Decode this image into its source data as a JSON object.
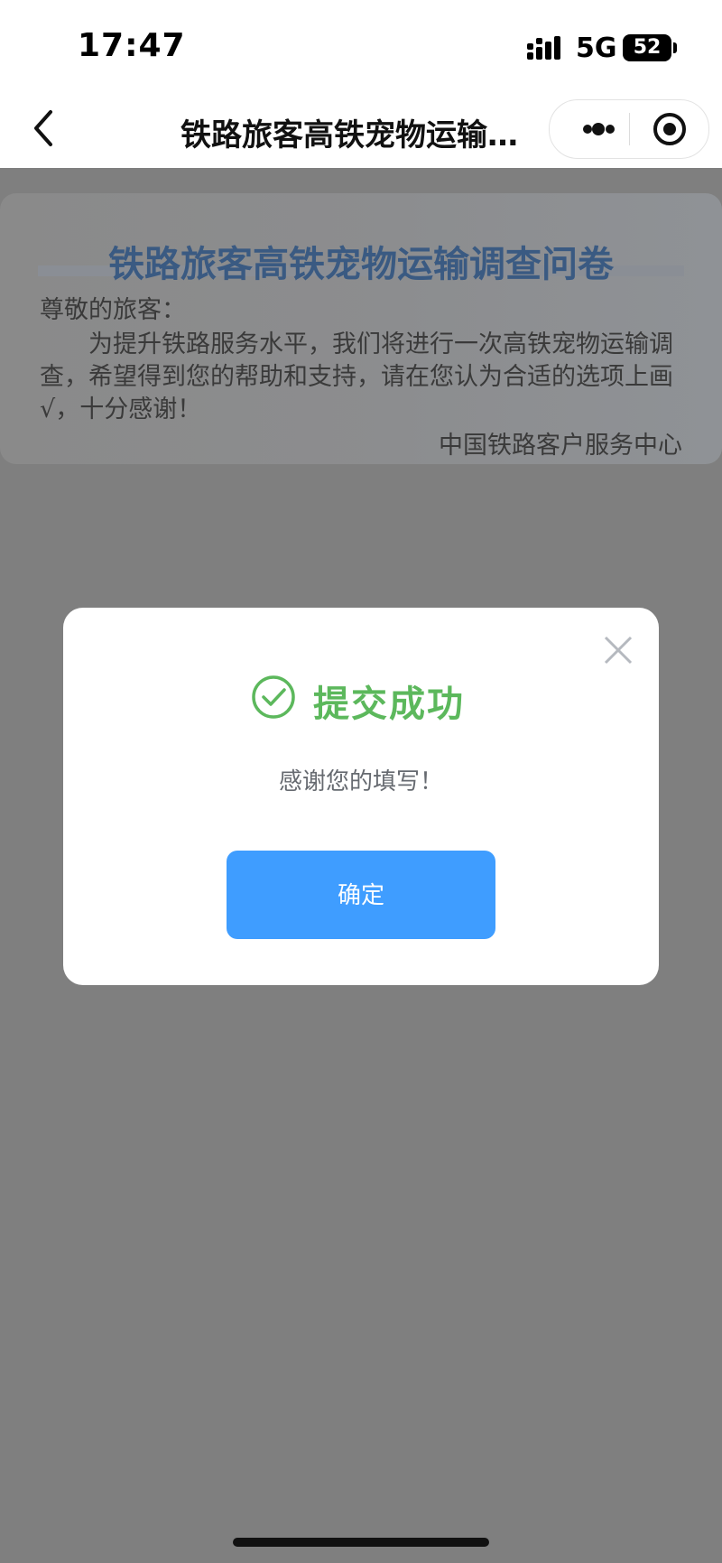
{
  "status_bar": {
    "time": "17:47",
    "network": "5G",
    "battery": "52"
  },
  "nav": {
    "title": "铁路旅客高铁宠物运输…",
    "icons": [
      "back-chevron-icon",
      "more-dots-icon",
      "close-target-icon"
    ]
  },
  "survey": {
    "title": "铁路旅客高铁宠物运输调查问卷",
    "greeting": "尊敬的旅客：",
    "intro": "为提升铁路服务水平，我们将进行一次高铁宠物运输调查，希望得到您的帮助和支持，请在您认为合适的选项上画√，十分感谢！",
    "signature": "中国铁路客户服务中心"
  },
  "dialog": {
    "title": "提交成功",
    "message": "感谢您的填写！",
    "confirm_label": "确定",
    "icons": [
      "check-circle-icon",
      "close-x-icon"
    ]
  },
  "colors": {
    "success_green": "#5cb85c",
    "confirm_blue": "#3f9dff",
    "overlay_gray": "#7f7f7f",
    "survey_title_blue": "#3a5a82"
  }
}
